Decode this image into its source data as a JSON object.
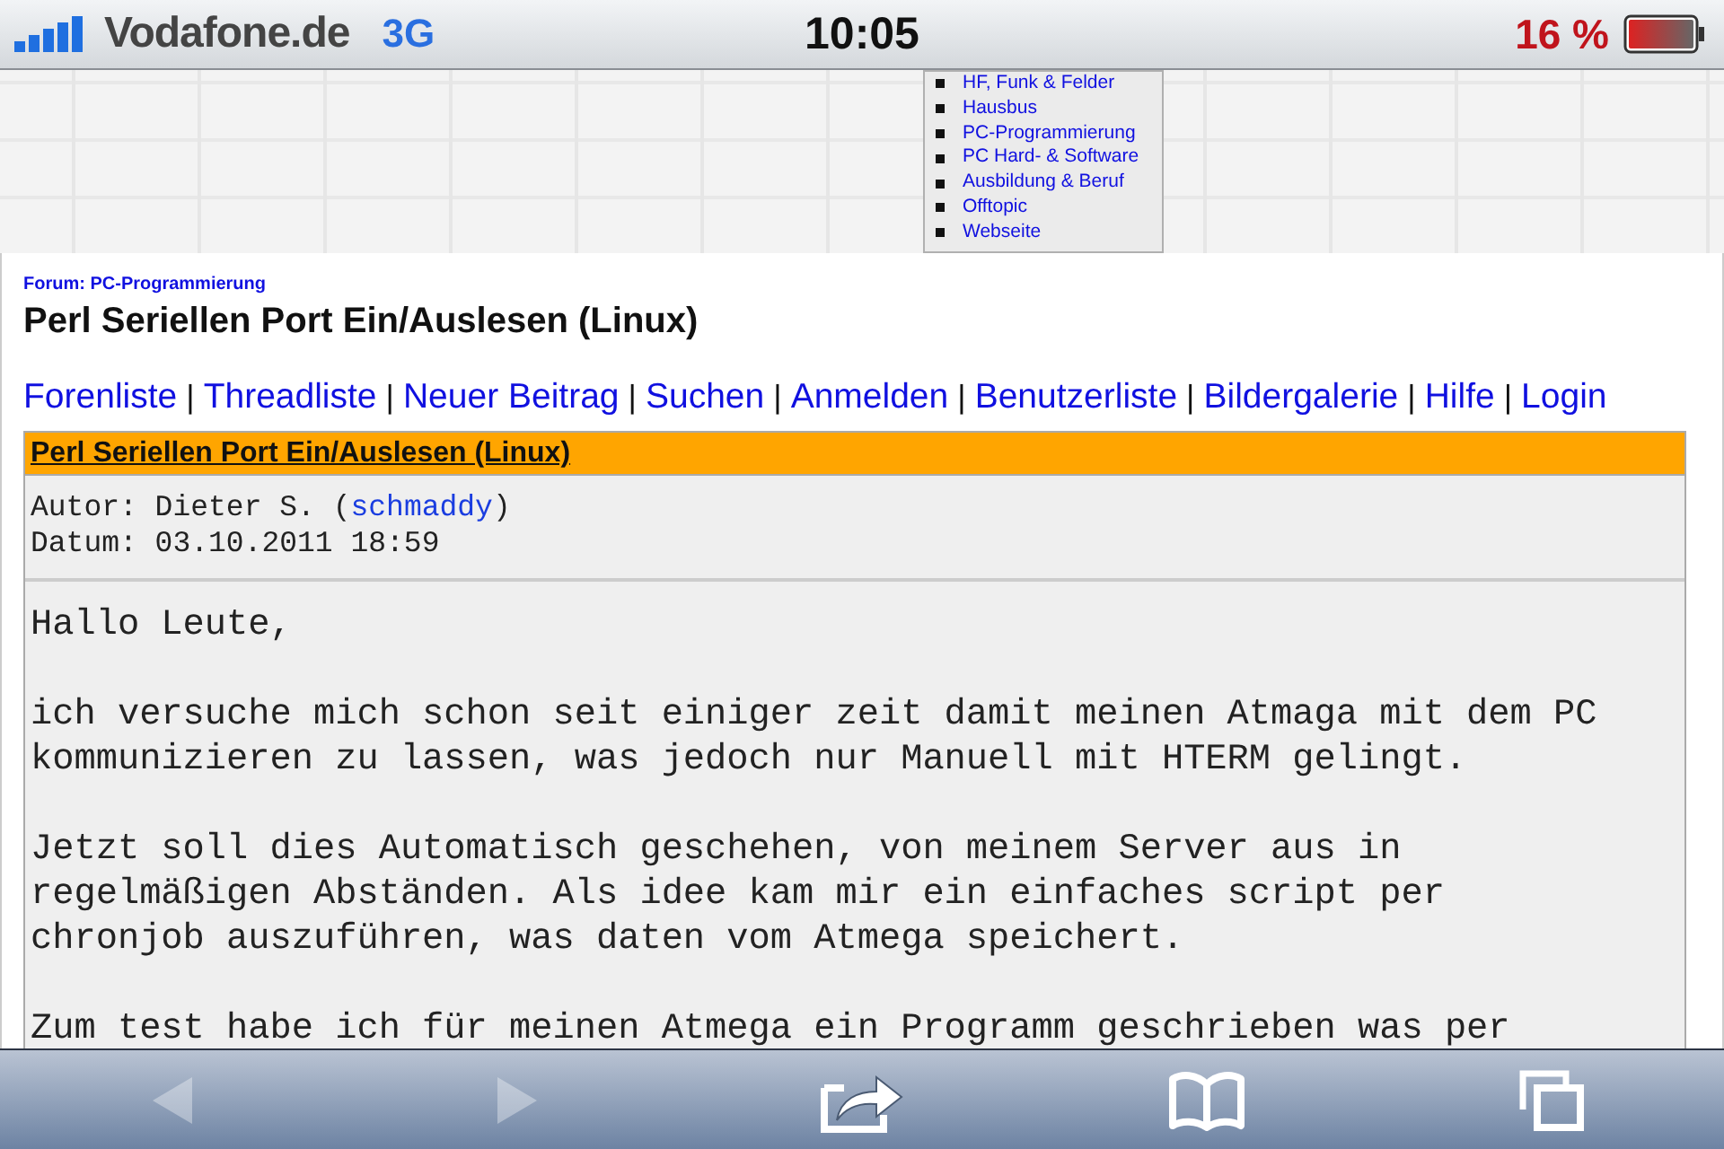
{
  "status_bar": {
    "carrier": "Vodafone.de",
    "network": "3G",
    "time": "10:05",
    "battery": "16 %"
  },
  "forum_menu": {
    "items": [
      "HF, Funk & Felder",
      "Hausbus",
      "PC-Programmierung",
      "PC Hard- & Software",
      "Ausbildung & Beruf",
      "Offtopic",
      "Webseite"
    ]
  },
  "page": {
    "forum": "Forum: PC-Programmierung",
    "title": "Perl Seriellen Port Ein/Auslesen (Linux)",
    "nav": [
      {
        "kind": "link",
        "label": "Forenliste"
      },
      {
        "kind": "separator",
        "label": "|"
      },
      {
        "kind": "link",
        "label": "Threadliste"
      },
      {
        "kind": "separator",
        "label": "|"
      },
      {
        "kind": "link",
        "label": "Neuer Beitrag"
      },
      {
        "kind": "separator",
        "label": "|"
      },
      {
        "kind": "link",
        "label": "Suchen"
      },
      {
        "kind": "separator",
        "label": "|"
      },
      {
        "kind": "link",
        "label": "Anmelden"
      },
      {
        "kind": "separator",
        "label": "|"
      },
      {
        "kind": "link",
        "label": "Benutzerliste"
      },
      {
        "kind": "separator",
        "label": "|"
      },
      {
        "kind": "link",
        "label": "Bildergalerie"
      },
      {
        "kind": "separator",
        "label": "|"
      },
      {
        "kind": "link",
        "label": "Hilfe"
      },
      {
        "kind": "separator",
        "label": "|"
      },
      {
        "kind": "link",
        "label": "Login"
      }
    ],
    "post": {
      "subject": "Perl Seriellen Port Ein/Auslesen (Linux)",
      "author_prefix": "Autor: Dieter S. (",
      "username": "schmaddy",
      "author_suffix": ")",
      "date": "Datum: 03.10.2011 18:59",
      "paragraphs": [
        "Hallo Leute,",
        "ich versuche mich schon seit einiger zeit damit meinen Atmaga mit dem PC\nkommunizieren zu lassen, was jedoch nur Manuell mit HTERM gelingt.",
        "Jetzt soll dies Automatisch geschehen, von meinem Server aus in\nregelmäßigen Abständen. Als idee kam mir ein einfaches script per\nchronjob auszuführen, was daten vom Atmega speichert.",
        "Zum test habe ich für meinen Atmega ein Programm geschrieben was per"
      ]
    }
  },
  "toolbar": [
    {
      "kind": "back",
      "disabled": true
    },
    {
      "kind": "forward",
      "disabled": true
    },
    {
      "kind": "share",
      "disabled": false
    },
    {
      "kind": "bookmarks",
      "disabled": false
    },
    {
      "kind": "tabs",
      "disabled": false
    }
  ]
}
